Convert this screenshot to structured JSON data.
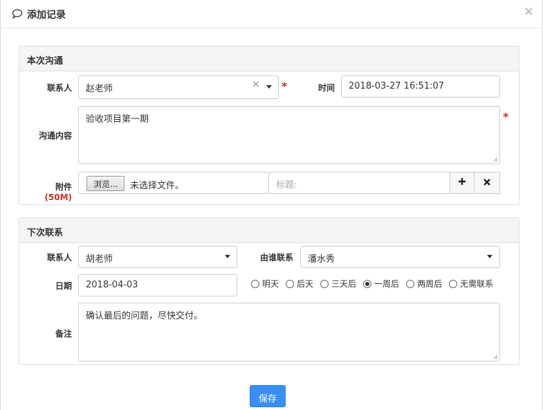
{
  "dialog": {
    "title": "添加记录",
    "close_label": "×"
  },
  "current": {
    "heading": "本次沟通",
    "contact_label": "联系人",
    "contact_value": "赵老师",
    "time_label": "时间",
    "time_value": "2018-03-27 16:51:07",
    "content_label": "沟通内容",
    "content_value": "验收项目第一期",
    "attach_label": "附件",
    "attach_limit": "(50M)",
    "browse_label": "浏览...",
    "file_status": "未选择文件。",
    "title_placeholder": "标题:",
    "required_mark": "*"
  },
  "next": {
    "heading": "下次联系",
    "contact_label": "联系人",
    "contact_value": "胡老师",
    "who_label": "由谁联系",
    "who_value": "潘水秀",
    "date_label": "日期",
    "date_value": "2018-04-03",
    "options": [
      {
        "label": "明天",
        "selected": false
      },
      {
        "label": "后天",
        "selected": false
      },
      {
        "label": "三天后",
        "selected": false
      },
      {
        "label": "一周后",
        "selected": true
      },
      {
        "label": "两周后",
        "selected": false
      },
      {
        "label": "无需联系",
        "selected": false
      }
    ],
    "note_label": "备注",
    "note_value": "确认最后的问题，尽快交付。"
  },
  "footer": {
    "save_label": "保存"
  },
  "colors": {
    "primary": "#3b8ff3",
    "required": "#c9302c"
  }
}
